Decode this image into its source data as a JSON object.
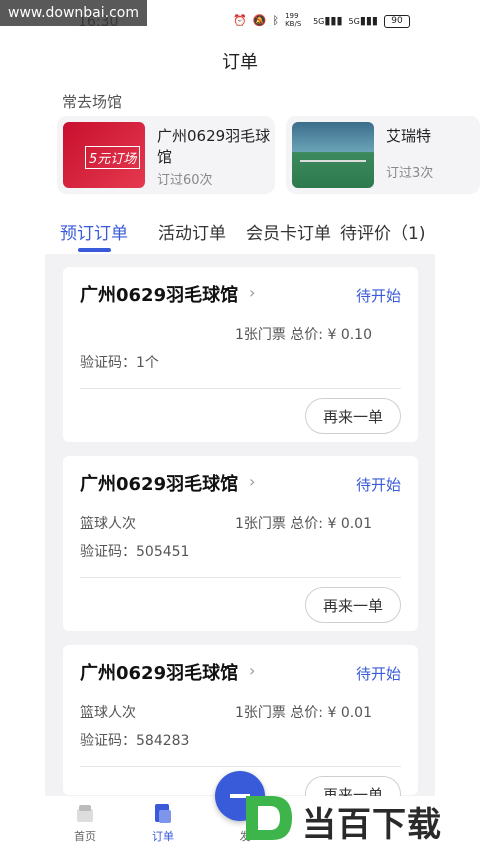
{
  "watermark": {
    "top": "www.downbai.com",
    "bottom": "当百下载"
  },
  "status_bar": {
    "time": "16:30",
    "net_speed": "199 KB/S",
    "sig1": "5G",
    "sig2": "5G",
    "battery": "90"
  },
  "header": {
    "title": "订单"
  },
  "frequent": {
    "label": "常去场馆",
    "venues": [
      {
        "name": "广州0629羽毛球馆",
        "sub": "订过60次",
        "thumb_text": "5元订场"
      },
      {
        "name": "艾瑞特",
        "sub": "订过3次"
      }
    ]
  },
  "tabs": [
    {
      "label": "预订订单",
      "active": true
    },
    {
      "label": "活动订单"
    },
    {
      "label": "会员卡订单"
    },
    {
      "label": "待评价（1)"
    }
  ],
  "orders": [
    {
      "venue": "广州0629羽毛球馆",
      "status": "待开始",
      "type": "",
      "price": "1张门票 总价: ¥ 0.10",
      "code": "验证码：1个",
      "button": "再来一单"
    },
    {
      "venue": "广州0629羽毛球馆",
      "status": "待开始",
      "type": "篮球人次",
      "price": "1张门票 总价: ¥ 0.01",
      "code": "验证码：505451",
      "button": "再来一单"
    },
    {
      "venue": "广州0629羽毛球馆",
      "status": "待开始",
      "type": "篮球人次",
      "price": "1张门票 总价: ¥ 0.01",
      "code": "验证码：584283",
      "button": "再来一单"
    }
  ],
  "nav": {
    "home": "首页",
    "order": "订单",
    "third": "发"
  },
  "colors": {
    "accent": "#3a5bd9"
  }
}
